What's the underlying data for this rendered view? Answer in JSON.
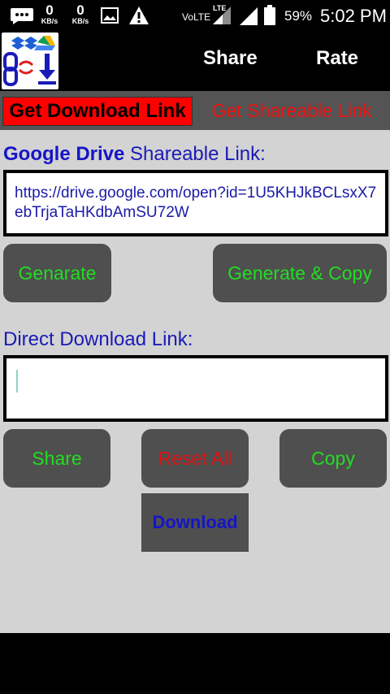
{
  "status_bar": {
    "speed1_value": "0",
    "speed1_unit": "KB/s",
    "speed2_value": "0",
    "speed2_unit": "KB/s",
    "network_label": "VoLTE",
    "lte_label": "LTE",
    "battery": "59%",
    "time": "5:02 PM"
  },
  "app_bar": {
    "share_label": "Share",
    "rate_label": "Rate"
  },
  "tabs": {
    "active_label": "Get Download Link",
    "inactive_label": "Get Shareable Link"
  },
  "drive_section": {
    "label_bold": "Google Drive",
    "label_rest": " Shareable Link:",
    "link_value": "https://drive.google.com/open?id=1U5KHJkBCLsxX7ebTrjaTaHKdbAmSU72W"
  },
  "buttons_row1": {
    "generate_label": "Genarate",
    "generate_copy_label": "Generate & Copy"
  },
  "direct_section": {
    "label": "Direct Download Link:",
    "value": ""
  },
  "buttons_row2": {
    "share_label": "Share",
    "reset_label": "Reset All",
    "copy_label": "Copy",
    "download_label": "Download"
  },
  "colors": {
    "green_text": "#22dd22",
    "red_text": "#ee1111",
    "blue_text": "#1515c8",
    "panel_gray": "#d3d3d3",
    "button_gray": "#4f4f4f"
  }
}
